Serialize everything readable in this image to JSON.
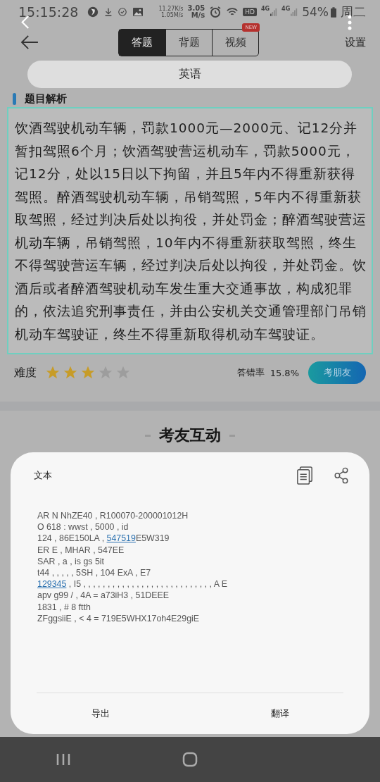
{
  "status_bar": {
    "time": "15:15:28",
    "speed_up": "11.27K/s",
    "speed_value": "3.05",
    "speed_down": "1.05M/s",
    "speed_unit": "M/s",
    "network_badge": "HD",
    "signal_1": "4G",
    "signal_2": "4G",
    "battery": "54%",
    "weekday": "周二"
  },
  "top_bar": {
    "tabs": [
      {
        "label": "答题",
        "selected": true
      },
      {
        "label": "背题",
        "selected": false
      },
      {
        "label": "视频",
        "selected": false,
        "badge": "NEW"
      }
    ],
    "settings": "设置"
  },
  "subject": "英语",
  "analysis": {
    "title": "题目解析",
    "text": "饮酒驾驶机动车辆，罚款1000元—2000元、记12分并暂扣驾照6个月；饮酒驾驶营运机动车，罚款5000元，记12分，处以15日以下拘留，并且5年内不得重新获得驾照。醉酒驾驶机动车辆，吊销驾照，5年内不得重新获取驾照，经过判决后处以拘役，并处罚金；醉酒驾驶营运机动车辆，吊销驾照，10年内不得重新获取驾照，终生不得驾驶营运车辆，经过判决后处以拘役，并处罚金。饮酒后或者醉酒驾驶机动车发生重大交通事故，构成犯罪的，依法追究刑事责任，并由公安机关交通管理部门吊销机动车驾驶证，终生不得重新取得机动车驾驶证。"
  },
  "difficulty": {
    "label": "难度",
    "stars": 3,
    "error_rate_label": "答错率",
    "error_rate": "15.8%",
    "button": "考朋友"
  },
  "interaction_title": "考友互动",
  "sheet": {
    "title": "文本",
    "lines": [
      {
        "parts": [
          {
            "text": "AR N NhZE40 , R100070-200001012H",
            "link": false
          }
        ]
      },
      {
        "parts": [
          {
            "text": "O 618 : wwst , 5000 , id",
            "link": false
          }
        ]
      },
      {
        "parts": [
          {
            "text": "124 , 86E150LA , ",
            "link": false
          },
          {
            "text": "547519",
            "link": true
          },
          {
            "text": "E5W319",
            "link": false
          }
        ]
      },
      {
        "parts": [
          {
            "text": "ER E , MHAR , 547EE",
            "link": false
          }
        ]
      },
      {
        "parts": [
          {
            "text": "SAR , a , is gs 5it",
            "link": false
          }
        ]
      },
      {
        "parts": [
          {
            "text": "t44 , , , , , 5SH , 104 ExA , E7",
            "link": false
          }
        ]
      },
      {
        "parts": [
          {
            "text": "129345",
            "link": true
          },
          {
            "text": " , I5 , , , , , , , , , , , , , , , , , , , , , , , , , , , A E",
            "link": false
          }
        ]
      },
      {
        "parts": [
          {
            "text": "apv g99 / , 4A = a73iH3 , 51DEEE",
            "link": false
          }
        ]
      },
      {
        "parts": [
          {
            "text": "1831 , # 8 ftth",
            "link": false
          }
        ]
      },
      {
        "parts": [
          {
            "text": "ZFggsiiE , < 4 = 719E5WHX17oh4E29giE",
            "link": false
          }
        ]
      }
    ],
    "actions": [
      "导出",
      "翻译"
    ]
  }
}
